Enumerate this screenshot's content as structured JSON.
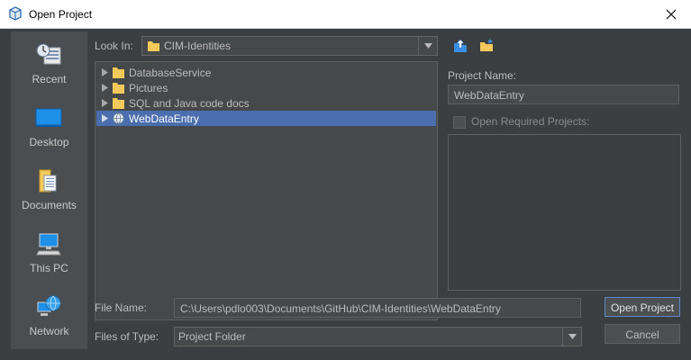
{
  "window": {
    "title": "Open Project",
    "close_icon": "close-icon"
  },
  "places": [
    {
      "label": "Recent",
      "icon": "recent-places-icon"
    },
    {
      "label": "Desktop",
      "icon": "desktop-icon"
    },
    {
      "label": "Documents",
      "icon": "documents-icon"
    },
    {
      "label": "This PC",
      "icon": "computer-icon"
    },
    {
      "label": "Network",
      "icon": "network-icon"
    }
  ],
  "look_in": {
    "label": "Look In:",
    "value": "CIM-Identities"
  },
  "toolbar": {
    "up_icon": "up-one-level-icon",
    "new_folder_icon": "new-folder-icon"
  },
  "files": [
    {
      "name": "DatabaseService",
      "icon": "folder-icon",
      "selected": false
    },
    {
      "name": "Pictures",
      "icon": "folder-icon",
      "selected": false
    },
    {
      "name": "SQL and Java code docs",
      "icon": "folder-icon",
      "selected": false
    },
    {
      "name": "WebDataEntry",
      "icon": "web-project-icon",
      "selected": true
    }
  ],
  "project": {
    "name_label": "Project Name:",
    "name_value": "WebDataEntry",
    "required_label": "Open Required Projects:",
    "required_checked": false
  },
  "file_name": {
    "label": "File Name:",
    "value": "C:\\Users\\pdlo003\\Documents\\GitHub\\CIM-Identities\\WebDataEntry"
  },
  "file_type": {
    "label": "Files of Type:",
    "value": "Project Folder"
  },
  "buttons": {
    "open": "Open Project",
    "cancel": "Cancel"
  },
  "colors": {
    "background": "#3c3f41",
    "selection": "#4b6eaf",
    "folder": "#f3c95b"
  }
}
